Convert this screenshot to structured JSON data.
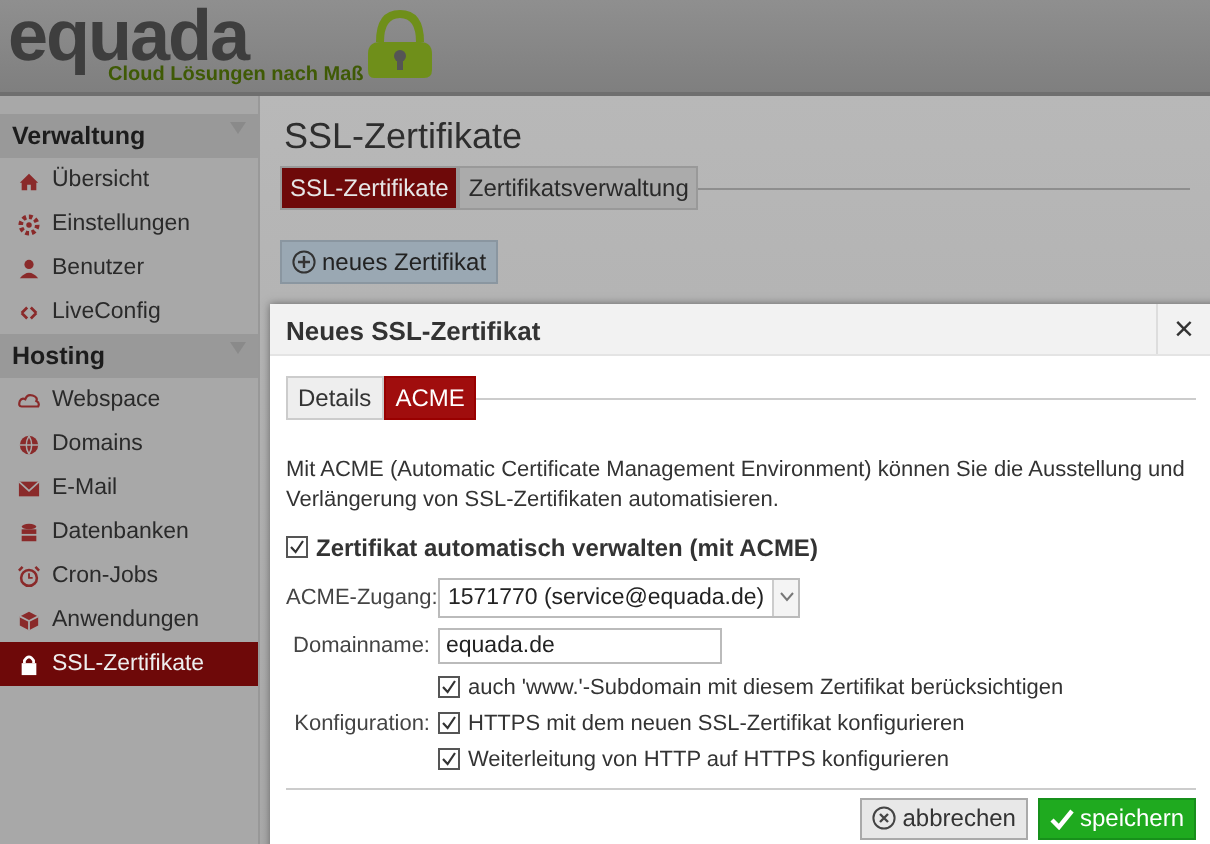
{
  "logo": {
    "name": "equada",
    "tagline": "Cloud Lösungen nach Maß"
  },
  "sidebar": {
    "sections": [
      {
        "title": "Verwaltung",
        "items": [
          {
            "label": "Übersicht",
            "selected": false
          },
          {
            "label": "Einstellungen",
            "selected": false
          },
          {
            "label": "Benutzer",
            "selected": false
          },
          {
            "label": "LiveConfig",
            "selected": false
          }
        ]
      },
      {
        "title": "Hosting",
        "items": [
          {
            "label": "Webspace",
            "selected": false
          },
          {
            "label": "Domains",
            "selected": false
          },
          {
            "label": "E-Mail",
            "selected": false
          },
          {
            "label": "Datenbanken",
            "selected": false
          },
          {
            "label": "Cron-Jobs",
            "selected": false
          },
          {
            "label": "Anwendungen",
            "selected": false
          },
          {
            "label": "SSL-Zertifikate",
            "selected": true
          }
        ]
      }
    ]
  },
  "page": {
    "title": "SSL-Zertifikate",
    "tabs": [
      {
        "label": "SSL-Zertifikate",
        "selected": true
      },
      {
        "label": "Zertifikatsverwaltung",
        "selected": false
      }
    ],
    "new_button": "neues Zertifikat"
  },
  "dialog": {
    "title": "Neues SSL-Zertifikat",
    "close": "×",
    "tabs": [
      {
        "label": "Details",
        "selected": false
      },
      {
        "label": "ACME",
        "selected": true
      }
    ],
    "description": "Mit ACME (Automatic Certificate Management Environment) können Sie die Ausstellung und Verlängerung von SSL-Zertifikaten automatisieren.",
    "auto_manage": {
      "label": "Zertifikat automatisch verwalten (mit ACME)",
      "checked": true
    },
    "acme_account": {
      "label": "ACME-Zugang:",
      "value": "1571770 (service@equada.de)"
    },
    "domain": {
      "label": "Domainname:",
      "value": "equada.de"
    },
    "options": [
      {
        "label": "auch 'www.'-Subdomain mit diesem Zertifikat berücksichtigen",
        "checked": true
      },
      {
        "group_label": "Konfiguration:",
        "label": "HTTPS mit dem neuen SSL-Zertifikat konfigurieren",
        "checked": true
      },
      {
        "label": "Weiterleitung von HTTP auf HTTPS konfigurieren",
        "checked": true
      }
    ],
    "buttons": [
      {
        "label": "abbrechen",
        "kind": "cancel"
      },
      {
        "label": "speichern",
        "kind": "save"
      }
    ]
  }
}
